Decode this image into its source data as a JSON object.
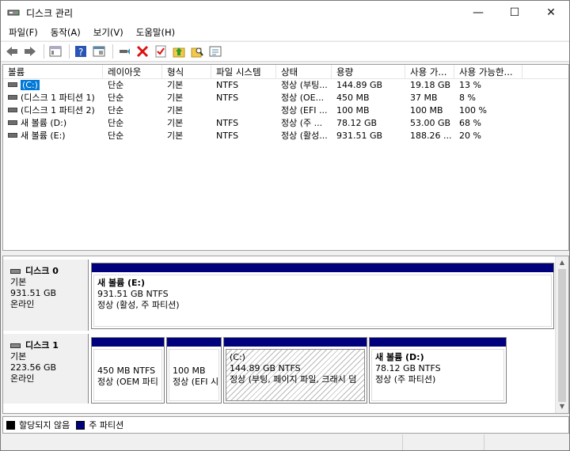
{
  "window": {
    "title": "디스크 관리",
    "minimize": "—",
    "maximize": "☐",
    "close": "✕"
  },
  "menu": [
    "파일(F)",
    "동작(A)",
    "보기(V)",
    "도움말(H)"
  ],
  "volume_list": {
    "columns": [
      "볼륨",
      "레이아웃",
      "형식",
      "파일 시스템",
      "상태",
      "용량",
      "사용 가...",
      "사용 가능한..."
    ],
    "rows": [
      {
        "volume": "(C:)",
        "layout": "단순",
        "type": "기본",
        "fs": "NTFS",
        "status": "정상 (부팅...",
        "capacity": "144.89 GB",
        "free": "19.18 GB",
        "pct": "13 %",
        "selected": true
      },
      {
        "volume": "(디스크 1 파티션 1)",
        "layout": "단순",
        "type": "기본",
        "fs": "NTFS",
        "status": "정상 (OE...",
        "capacity": "450 MB",
        "free": "37 MB",
        "pct": "8 %",
        "selected": false
      },
      {
        "volume": "(디스크 1 파티션 2)",
        "layout": "단순",
        "type": "기본",
        "fs": "",
        "status": "정상 (EFI ...",
        "capacity": "100 MB",
        "free": "100 MB",
        "pct": "100 %",
        "selected": false
      },
      {
        "volume": "새 볼륨 (D:)",
        "layout": "단순",
        "type": "기본",
        "fs": "NTFS",
        "status": "정상 (주 ...",
        "capacity": "78.12 GB",
        "free": "53.00 GB",
        "pct": "68 %",
        "selected": false
      },
      {
        "volume": "새 볼륨 (E:)",
        "layout": "단순",
        "type": "기본",
        "fs": "NTFS",
        "status": "정상 (활성...",
        "capacity": "931.51 GB",
        "free": "188.26 ...",
        "pct": "20 %",
        "selected": false
      }
    ]
  },
  "disks": [
    {
      "name": "디스크 0",
      "kind": "기본",
      "size": "931.51 GB",
      "state": "온라인",
      "partitions": [
        {
          "title": "새 볼륨  (E:)",
          "line1": "931.51 GB NTFS",
          "line2": "정상 (활성, 주 파티션)"
        }
      ]
    },
    {
      "name": "디스크 1",
      "kind": "기본",
      "size": "223.56 GB",
      "state": "온라인",
      "partitions": [
        {
          "title": "",
          "line1": "450 MB NTFS",
          "line2": "정상 (OEM 파티"
        },
        {
          "title": "",
          "line1": "100 MB",
          "line2": "정상 (EFI 시"
        },
        {
          "title": "(C:)",
          "line1": "144.89 GB NTFS",
          "line2": "정상 (부팅, 페이지 파일, 크래시 덤"
        },
        {
          "title": "새 볼륨  (D:)",
          "line1": "78.12 GB NTFS",
          "line2": "정상 (주 파티션)"
        }
      ]
    }
  ],
  "legend": {
    "unallocated": "할당되지 않음",
    "primary": "주 파티션",
    "unallocated_color": "#000000",
    "primary_color": "#00007d"
  },
  "icons": [
    "back-icon",
    "forward-icon",
    "properties-icon",
    "help-icon",
    "console-icon",
    "connect-icon",
    "delete-icon",
    "check-icon",
    "folder-up-icon",
    "search-folder-icon",
    "settings-icon"
  ]
}
